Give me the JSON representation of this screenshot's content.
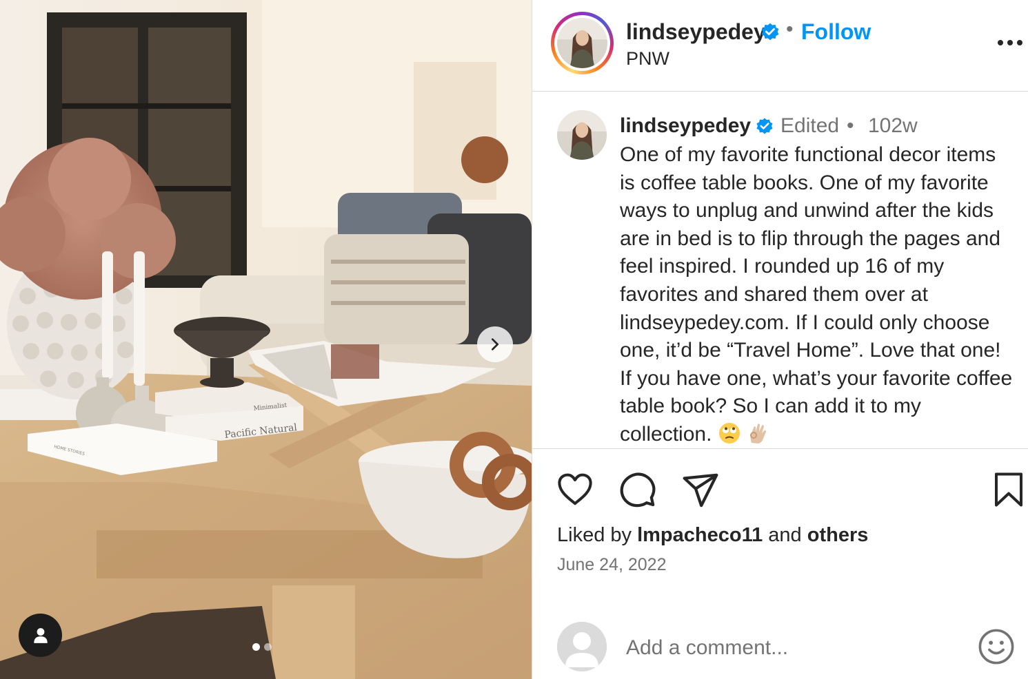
{
  "post": {
    "username": "lindseypedey",
    "location": "PNW",
    "follow_label": "Follow",
    "separator": "•"
  },
  "caption": {
    "username": "lindseypedey",
    "edited": "Edited",
    "separator": "•",
    "time": "102w",
    "text": "One of my favorite functional decor items is coffee table books. One of my favorite ways to unplug and unwind after the kids are in bed is to flip through the pages and feel inspired. I rounded up 16 of my favorites and shared them over at lindseypedey.com. If I could only choose one, it’d be “Travel Home”. Love that one! If you have one, what’s your favorite coffee table book? So I can add it to my collection.",
    "emojis": [
      "face-with-rolling-eyes-emoji",
      "ok-hand-emoji"
    ]
  },
  "photo": {
    "book_spine_1": "Minimalist",
    "book_spine_2": "Pacific Natural",
    "book_cover": "HOME STORIES",
    "carousel_total": 2,
    "carousel_index": 1
  },
  "likes": {
    "prefix": "Liked by",
    "user": "lmpacheco11",
    "conj": "and",
    "others": "others"
  },
  "date": "June 24, 2022",
  "comment": {
    "placeholder": "Add a comment..."
  },
  "colors": {
    "accent": "#0095f6",
    "verified": "#0095f6",
    "text": "#262626",
    "muted": "#737373",
    "divider": "#dbdbdb"
  },
  "icons": [
    "chevron-right-icon",
    "user-tag-icon",
    "verified-badge-icon",
    "more-options-icon",
    "heart-icon",
    "comment-icon",
    "share-icon",
    "bookmark-icon",
    "emoji-icon"
  ]
}
